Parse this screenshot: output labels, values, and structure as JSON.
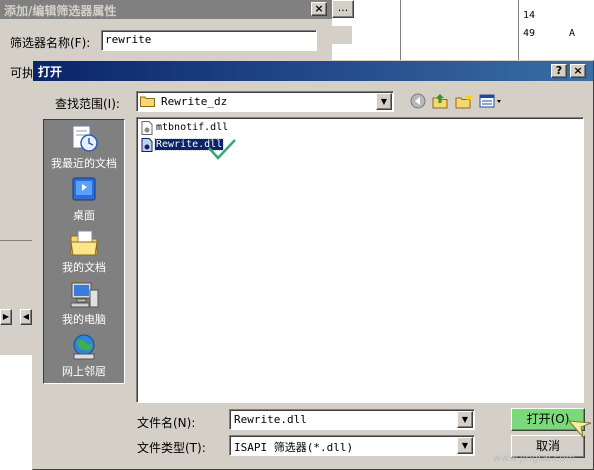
{
  "background_dialog": {
    "title": "添加/编辑筛选器属性",
    "filter_name_label": "筛选器名称(F):",
    "filter_name_value": "rewrite",
    "executable_label": "可执",
    "close_symbol": "×",
    "dots_label": "..."
  },
  "background_list": {
    "rows": [
      {
        "col1": "14",
        "col2": ""
      },
      {
        "col1": "49",
        "col2": "A"
      }
    ]
  },
  "open_dialog": {
    "title": "打开",
    "help_symbol": "?",
    "close_symbol": "×",
    "look_in_label": "查找范围(I):",
    "look_in_value": "Rewrite_dz",
    "places": [
      {
        "label": "我最近的文档",
        "icon": "recent-documents-icon"
      },
      {
        "label": "桌面",
        "icon": "desktop-icon"
      },
      {
        "label": "我的文档",
        "icon": "my-documents-icon"
      },
      {
        "label": "我的电脑",
        "icon": "my-computer-icon"
      },
      {
        "label": "网上邻居",
        "icon": "network-places-icon"
      }
    ],
    "files": [
      {
        "name": "mtbnotif.dll",
        "selected": false
      },
      {
        "name": "Rewrite.dll",
        "selected": true
      }
    ],
    "file_name_label": "文件名(N):",
    "file_name_value": "Rewrite.dll",
    "file_type_label": "文件类型(T):",
    "file_type_value": "ISAPI 筛选器(*.dll)",
    "open_button": "打开(O)",
    "cancel_button": "取消"
  },
  "watermark": "www.jingtai.com",
  "colors": {
    "titlebar_active": "#0a246a",
    "selection": "#0a246a",
    "open_button_highlight": "#7bd87b",
    "dialog_face": "#d4d0c8"
  }
}
